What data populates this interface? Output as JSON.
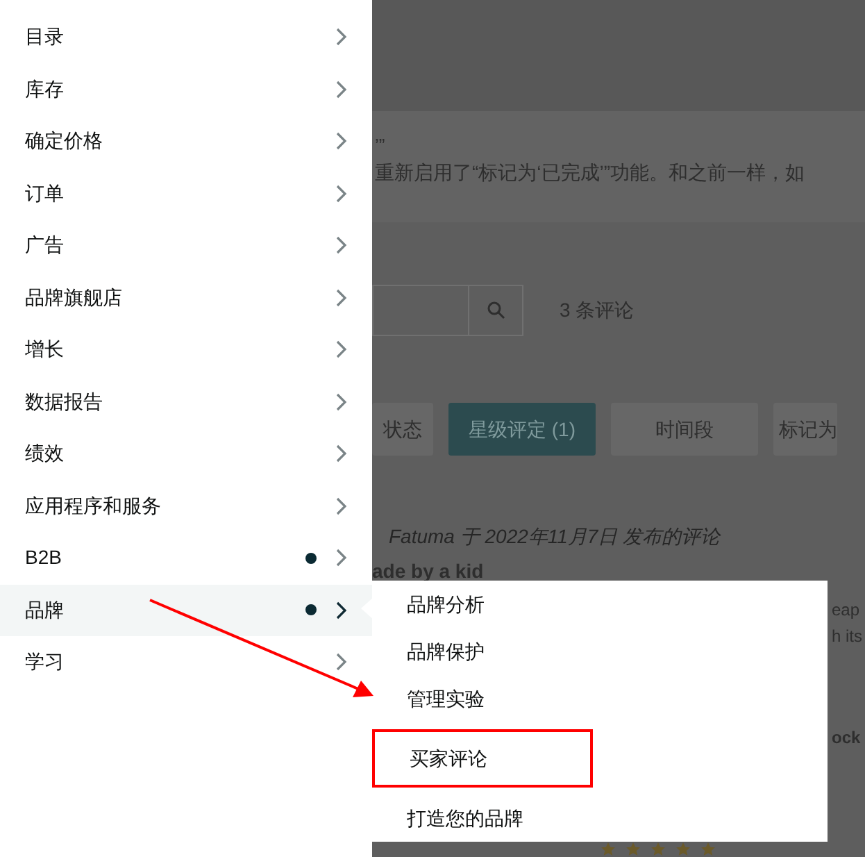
{
  "menu": {
    "items": [
      {
        "label": "目录",
        "dot": false,
        "selected": false
      },
      {
        "label": "库存",
        "dot": false,
        "selected": false
      },
      {
        "label": "确定价格",
        "dot": false,
        "selected": false
      },
      {
        "label": "订单",
        "dot": false,
        "selected": false
      },
      {
        "label": "广告",
        "dot": false,
        "selected": false
      },
      {
        "label": "品牌旗舰店",
        "dot": false,
        "selected": false
      },
      {
        "label": "增长",
        "dot": false,
        "selected": false
      },
      {
        "label": "数据报告",
        "dot": false,
        "selected": false
      },
      {
        "label": "绩效",
        "dot": false,
        "selected": false
      },
      {
        "label": "应用程序和服务",
        "dot": false,
        "selected": false
      },
      {
        "label": "B2B",
        "dot": true,
        "selected": false
      },
      {
        "label": "品牌",
        "dot": true,
        "selected": true
      },
      {
        "label": "学习",
        "dot": false,
        "selected": false
      }
    ]
  },
  "submenu": {
    "items": [
      {
        "label": "品牌分析",
        "highlighted": false
      },
      {
        "label": "品牌保护",
        "highlighted": false
      },
      {
        "label": "管理实验",
        "highlighted": false
      },
      {
        "label": "买家评论",
        "highlighted": true
      },
      {
        "label": "打造您的品牌",
        "highlighted": false
      }
    ]
  },
  "background_page": {
    "banner": {
      "quote_end": "’”",
      "text": "重新启用了“标记为‘已完成’”功能。和之前一样，如"
    },
    "search": {
      "result_count": "3 条评论"
    },
    "filters": [
      {
        "label": "状态",
        "selected": false
      },
      {
        "label": "星级评定 (1)",
        "selected": true
      },
      {
        "label": "时间段",
        "selected": false
      },
      {
        "label": "标记为",
        "selected": false
      }
    ],
    "review": {
      "byline": "Fatuma 于 2022年11月7日 发布的评论",
      "title": "ade by a kid",
      "fragments": [
        "eap",
        "h its",
        "ock"
      ],
      "stars": 5
    }
  }
}
